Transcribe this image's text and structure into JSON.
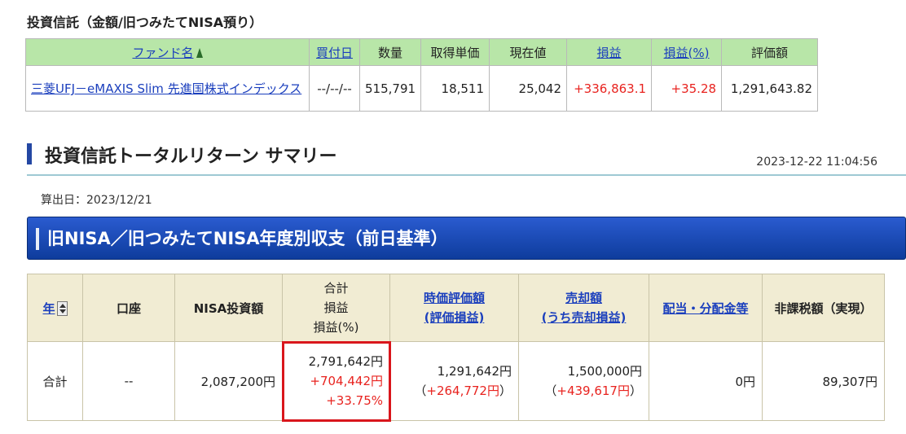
{
  "fund_section": {
    "title": "投資信託（金額/旧つみたてNISA預り）",
    "headers": [
      "ファンド名",
      "買付日",
      "数量",
      "取得単価",
      "現在値",
      "損益",
      "損益(%)",
      "評価額"
    ],
    "row": {
      "fund_name": "三菱UFJ－eMAXIS Slim 先進国株式インデックス",
      "purchase_date": "--/--/--",
      "quantity": "515,791",
      "acquisition_price": "18,511",
      "current_price": "25,042",
      "pl": "+336,863.1",
      "pl_pct": "+35.28",
      "valuation": "1,291,643.82"
    }
  },
  "summary": {
    "title": "投資信託トータルリターン サマリー",
    "timestamp": "2023-12-22 11:04:56",
    "calc_date": "算出日：2023/12/21"
  },
  "nisa_section": {
    "title": "旧NISA／旧つみたてNISA年度別収支（前日基準）",
    "headers": {
      "year": "年",
      "account": "口座",
      "invest": "NISA投資額",
      "total_l1": "合計",
      "total_l2": "損益",
      "total_l3": "損益(%)",
      "market_l1": "時価評価額",
      "market_l2": "(評価損益)",
      "sale_l1": "売却額",
      "sale_l2": "(うち売却損益)",
      "dividend": "配当・分配金等",
      "tax_exempt": "非課税額（実現）"
    },
    "row": {
      "year": "合計",
      "account": "--",
      "invest": "2,087,200円",
      "total": "2,791,642円",
      "total_pl": "+704,442円",
      "total_pct": "+33.75%",
      "market": "1,291,642円",
      "market_pl_open": "（",
      "market_pl": "+264,772円",
      "market_pl_close": "）",
      "sale": "1,500,000円",
      "sale_pl_open": "（",
      "sale_pl": "+439,617円",
      "sale_pl_close": "）",
      "dividend": "0円",
      "tax_exempt": "89,307円"
    }
  },
  "colors": {
    "header_green": "#b8e6a8",
    "header_beige": "#f1ecd3",
    "link_blue": "#1b3fbd",
    "positive_red": "#e8231f",
    "banner_blue": "#1a4bb8",
    "highlight_red": "#d9161c"
  },
  "icons": {
    "sort": "sort-updown-icon",
    "fund_sort": "tree-icon"
  }
}
